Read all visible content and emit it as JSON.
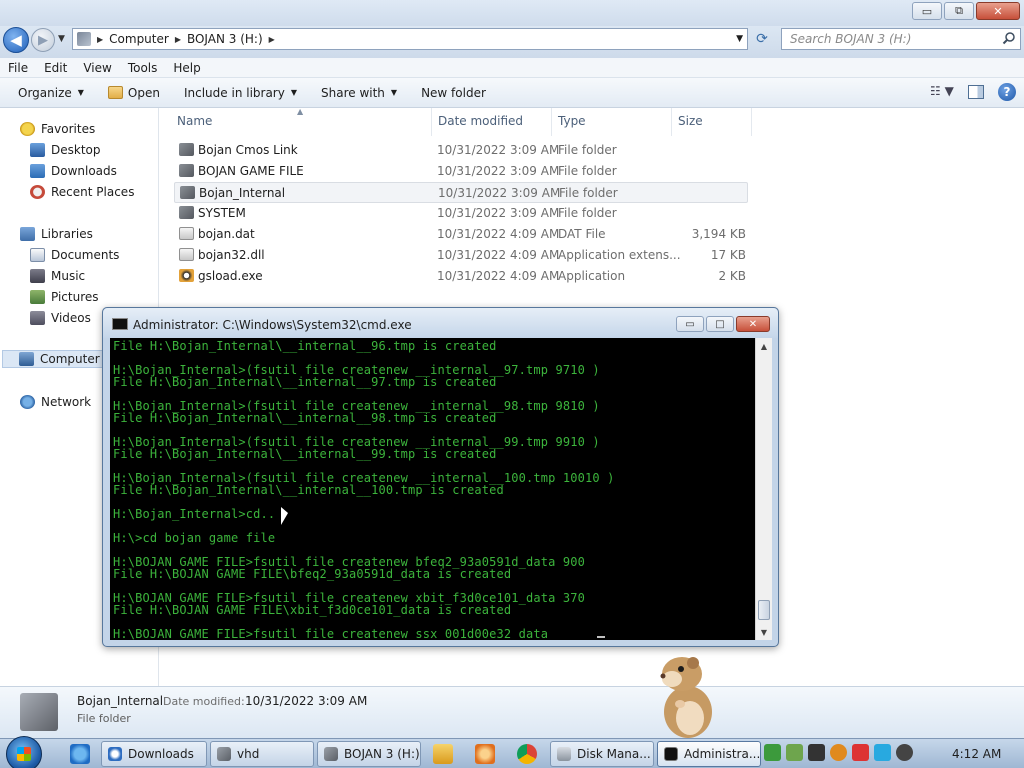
{
  "window": {
    "minimize_glyph": "▭",
    "maximize_glyph": "⧉",
    "close_glyph": "✕"
  },
  "address": {
    "back_glyph": "◀",
    "forward_glyph": "▶",
    "segments": [
      "Computer",
      "BOJAN 3 (H:)"
    ],
    "search_placeholder": "Search BOJAN 3 (H:)"
  },
  "menu": [
    "File",
    "Edit",
    "View",
    "Tools",
    "Help"
  ],
  "toolbar": {
    "organize": "Organize",
    "open": "Open",
    "include_in_library": "Include in library",
    "share_with": "Share with",
    "new_folder": "New folder",
    "help_glyph": "?"
  },
  "navpane": {
    "favorites": "Favorites",
    "desktop": "Desktop",
    "downloads": "Downloads",
    "recent_places": "Recent Places",
    "libraries": "Libraries",
    "documents": "Documents",
    "music": "Music",
    "pictures": "Pictures",
    "videos": "Videos",
    "computer": "Computer",
    "network": "Network"
  },
  "columns": {
    "name": "Name",
    "date_modified": "Date modified",
    "type": "Type",
    "size": "Size"
  },
  "files": [
    {
      "name": "Bojan Cmos Link",
      "date": "10/31/2022 3:09 AM",
      "type": "File folder",
      "size": "",
      "icon": "folder-icon"
    },
    {
      "name": "BOJAN GAME FILE",
      "date": "10/31/2022 3:09 AM",
      "type": "File folder",
      "size": "",
      "icon": "folder-icon"
    },
    {
      "name": "Bojan_Internal",
      "date": "10/31/2022 3:09 AM",
      "type": "File folder",
      "size": "",
      "icon": "folder-icon",
      "selected": true
    },
    {
      "name": "SYSTEM",
      "date": "10/31/2022 3:09 AM",
      "type": "File folder",
      "size": "",
      "icon": "folder-icon"
    },
    {
      "name": "bojan.dat",
      "date": "10/31/2022 4:09 AM",
      "type": "DAT File",
      "size": "3,194 KB",
      "icon": "file-icon"
    },
    {
      "name": "bojan32.dll",
      "date": "10/31/2022 4:09 AM",
      "type": "Application extens...",
      "size": "17 KB",
      "icon": "file-icon"
    },
    {
      "name": "gsload.exe",
      "date": "10/31/2022 4:09 AM",
      "type": "Application",
      "size": "2 KB",
      "icon": "exe-icon"
    }
  ],
  "details": {
    "name": "Bojan_Internal",
    "modified_label": "Date modified:",
    "modified_value": "10/31/2022 3:09 AM",
    "type": "File folder"
  },
  "cmd": {
    "title": "Administrator: C:\\Windows\\System32\\cmd.exe",
    "minimize_glyph": "▭",
    "maximize_glyph": "□",
    "close_glyph": "✕",
    "lines": [
      "File H:\\Bojan_Internal\\__internal__96.tmp is created",
      "",
      "H:\\Bojan_Internal>(fsutil file createnew __internal__97.tmp 9710 )",
      "File H:\\Bojan_Internal\\__internal__97.tmp is created",
      "",
      "H:\\Bojan_Internal>(fsutil file createnew __internal__98.tmp 9810 )",
      "File H:\\Bojan_Internal\\__internal__98.tmp is created",
      "",
      "H:\\Bojan_Internal>(fsutil file createnew __internal__99.tmp 9910 )",
      "File H:\\Bojan_Internal\\__internal__99.tmp is created",
      "",
      "H:\\Bojan_Internal>(fsutil file createnew __internal__100.tmp 10010 )",
      "File H:\\Bojan_Internal\\__internal__100.tmp is created",
      "",
      "H:\\Bojan_Internal>cd..",
      "",
      "H:\\>cd bojan game file",
      "",
      "H:\\BOJAN GAME FILE>fsutil file createnew bfeq2_93a0591d_data 900",
      "File H:\\BOJAN GAME FILE\\bfeq2_93a0591d_data is created",
      "",
      "H:\\BOJAN GAME FILE>fsutil file createnew xbit_f3d0ce101_data 370",
      "File H:\\BOJAN GAME FILE\\xbit_f3d0ce101_data is created",
      "",
      "H:\\BOJAN GAME FILE>fsutil file createnew ssx_001d00e32_data"
    ]
  },
  "taskbar": {
    "tasks": [
      "Downloads",
      "vhd",
      "BOJAN 3 (H:)",
      "Disk Mana...",
      "Administra..."
    ],
    "clock": "4:12 AM"
  }
}
